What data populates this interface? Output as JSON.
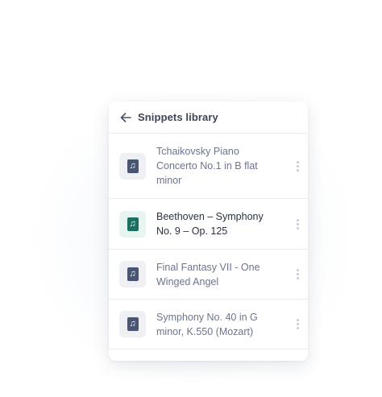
{
  "panel": {
    "title": "Snippets library",
    "back_icon": "arrow-left-icon"
  },
  "items": [
    {
      "title": "Tchaikovsky Piano Concerto No.1 in B flat minor",
      "icon": "music-note-icon",
      "selected": false
    },
    {
      "title": "Beethoven – Symphony No.  9 – Op. 125",
      "icon": "music-note-icon",
      "selected": true
    },
    {
      "title": "Final Fantasy VII - One Winged Angel",
      "icon": "music-note-icon",
      "selected": false
    },
    {
      "title": "Symphony No. 40 in G minor, K.550 (Mozart)",
      "icon": "music-note-icon",
      "selected": false
    }
  ],
  "colors": {
    "accent": "#1d6f62",
    "accent_bg": "#e7f4f2",
    "muted_text": "#6c7590",
    "dark_text": "#2b3142"
  }
}
